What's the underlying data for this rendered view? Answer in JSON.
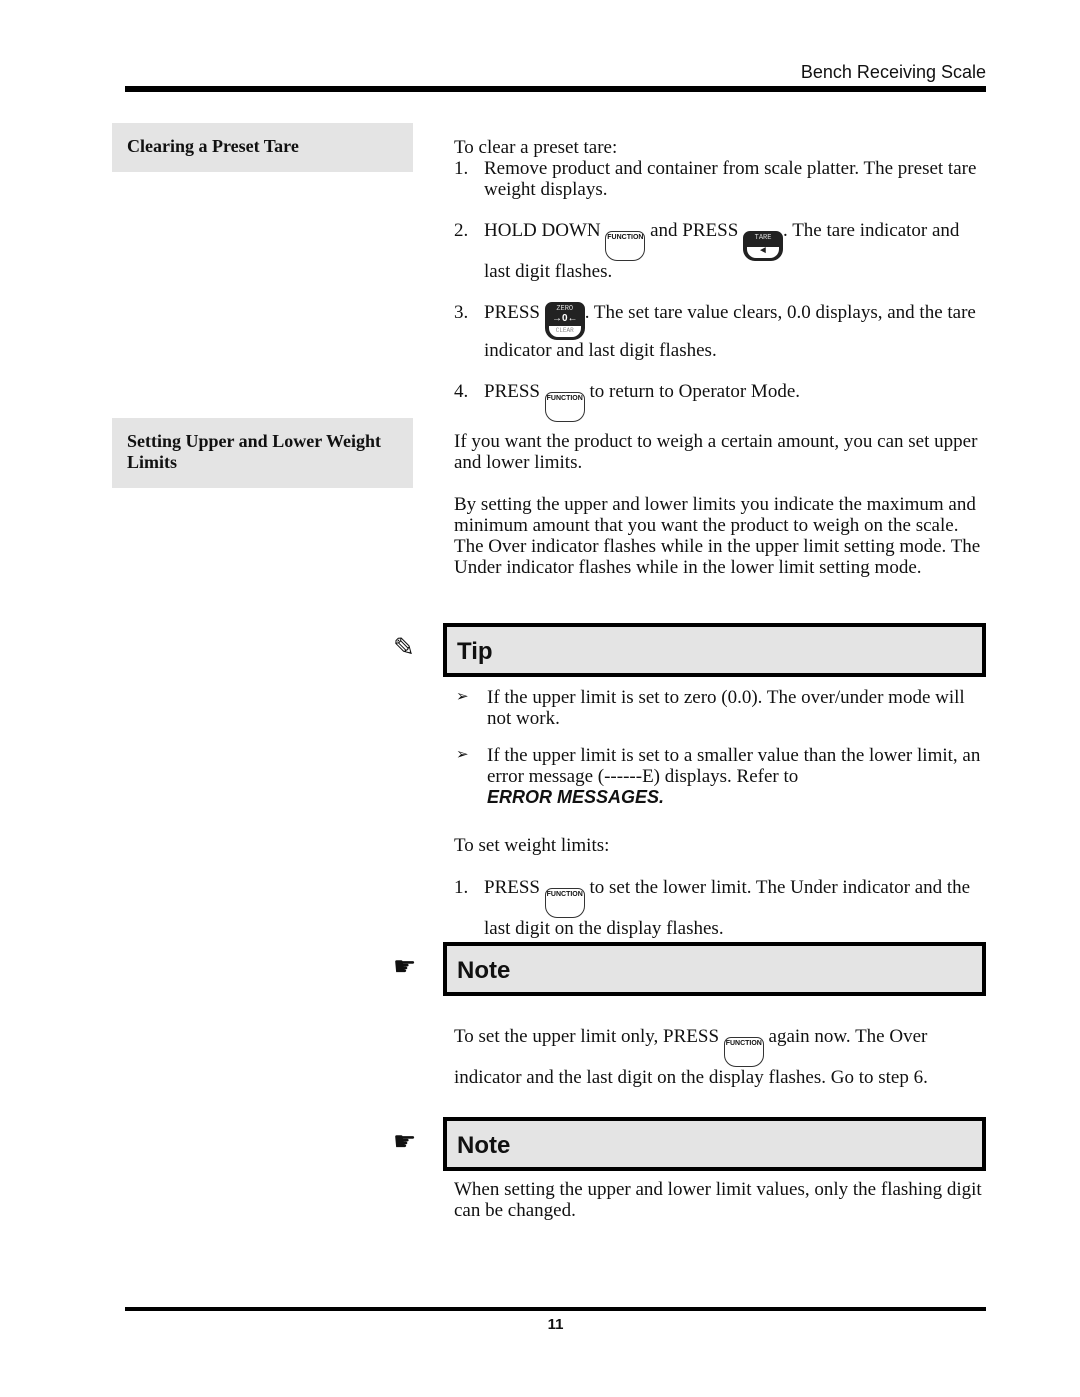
{
  "header": {
    "title": "Bench Receiving Scale"
  },
  "footer": {
    "page_number": "11"
  },
  "sections": {
    "clearing": {
      "heading": "Clearing a Preset Tare",
      "intro": "To clear a preset tare:",
      "steps": [
        {
          "num": "1.",
          "text": "Remove product and container from scale platter. The preset tare weight displays."
        },
        {
          "num": "2.",
          "pre": "HOLD DOWN",
          "mid": "and PRESS",
          "post": ". The tare indicator and last digit flashes."
        },
        {
          "num": "3.",
          "pre": "PRESS",
          "post": ". The set tare value clears, 0.0 displays, and the tare indicator and last digit flashes."
        },
        {
          "num": "4.",
          "pre": "PRESS",
          "post": "to return to Operator Mode."
        }
      ]
    },
    "limits": {
      "heading": "Setting Upper and Lower Weight Limits",
      "para1": "If you want the product to weigh a certain amount, you can set upper and lower limits.",
      "para2": "By setting the upper and lower limits you indicate the maximum and minimum amount that you want the product to weigh on the scale. The Over indicator flashes while in the upper limit setting mode. The Under indicator flashes while in the lower limit setting mode.",
      "tip": {
        "label": "Tip",
        "icon": "pencil-icon",
        "bullets": [
          "If the upper limit is set to zero (0.0). The over/under mode will not work.",
          "If the upper limit is set to a smaller value than the lower limit, an error message (------E) displays. Refer to"
        ],
        "xref": "ERROR MESSAGES",
        "xref_suffix": "."
      },
      "set_intro": "To set weight limits:",
      "step1": {
        "num": "1.",
        "pre": "PRESS",
        "post": "to set the lower limit. The Under indicator and the last digit on the display flashes."
      },
      "note1": {
        "label": "Note",
        "icon": "pointing-hand-icon",
        "pre": "To set the upper limit only, PRESS",
        "post": "again now. The Over indicator and the last digit on the display flashes. Go to step 6."
      },
      "note2": {
        "label": "Note",
        "icon": "pointing-hand-icon",
        "text": "When setting the upper and lower limit values, only the flashing digit can be changed."
      }
    }
  },
  "keys": {
    "function": "FUNCTION",
    "tare_top": "TARE",
    "tare_bottom": "◄",
    "zero_top": "ZERO",
    "zero_mid": "→0←",
    "zero_bottom": "CLEAR"
  },
  "glyphs": {
    "pencil": "✎",
    "hand": "☛",
    "arrow": "➢"
  }
}
